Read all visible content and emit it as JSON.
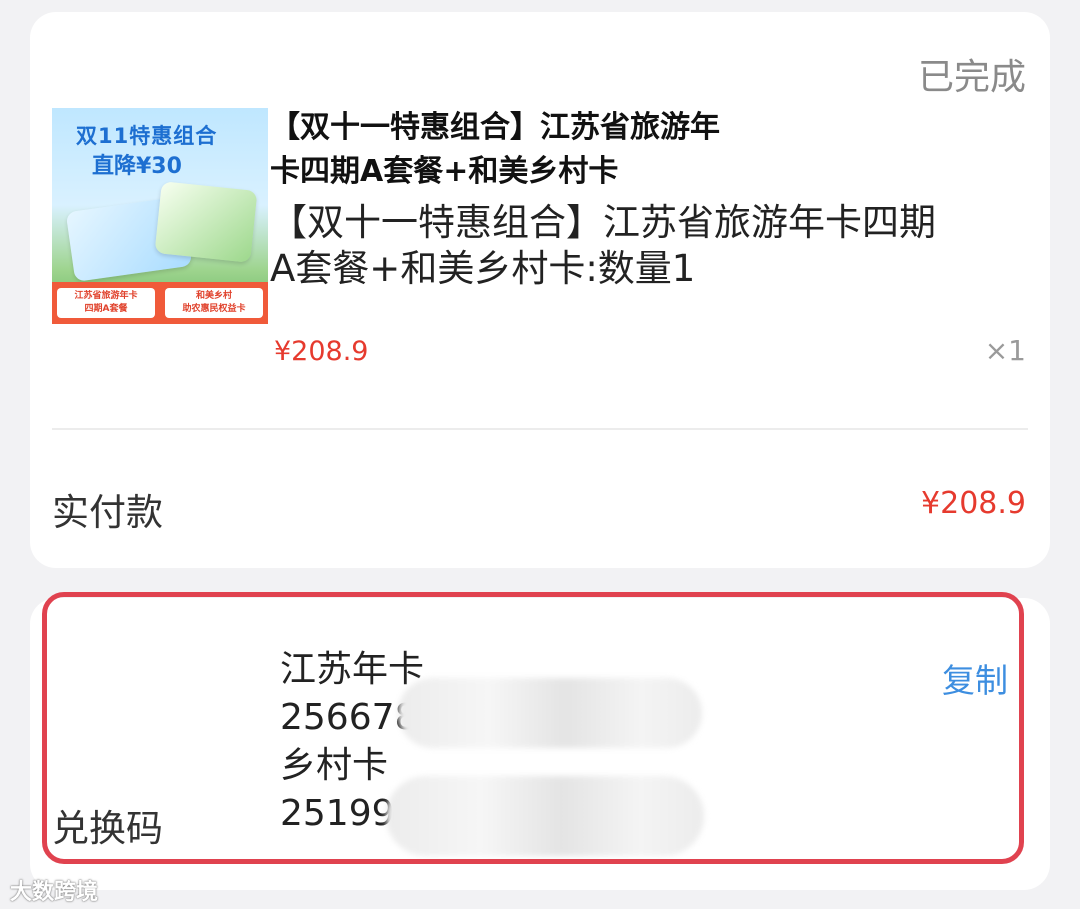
{
  "order": {
    "status": "已完成",
    "product": {
      "thumbnail": {
        "line1": "双11特惠组合",
        "line2": "直降¥30",
        "card_left": "江苏省旅游年卡\n四期A套餐",
        "card_right": "和美乡村\n助农惠民权益卡"
      },
      "title": "【双十一特惠组合】江苏省旅游年\n卡四期A套餐+和美乡村卡",
      "spec": "【双十一特惠组合】江苏省旅游年卡四期\nA套餐+和美乡村卡:数量1",
      "price": "¥208.9",
      "quantity": "×1"
    },
    "paid_label": "实付款",
    "paid_amount": "¥208.9"
  },
  "redeem": {
    "label": "兑换码",
    "copy_label": "复制",
    "lines": [
      "江苏年卡",
      "256678",
      "乡村卡",
      "25199"
    ]
  },
  "watermark": "大数跨境"
}
